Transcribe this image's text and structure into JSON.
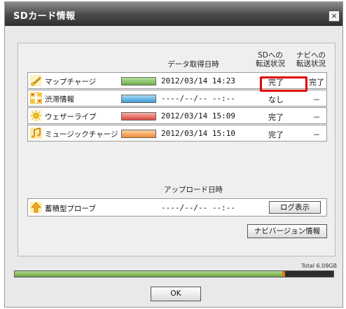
{
  "window": {
    "title": "SDカード情報",
    "close_label": "×"
  },
  "headers": {
    "date": "データ取得日時",
    "sd_line1": "SDへの",
    "sd_line2": "転送状況",
    "navi_line1": "ナビへの",
    "navi_line2": "転送状況"
  },
  "rows": [
    {
      "label": "マップチャージ",
      "date": "2012/03/14 14:23",
      "sd": "完了",
      "navi": "完了",
      "icon": "map-icon",
      "color": "#7fc163"
    },
    {
      "label": "渋滞情報",
      "date": "----/--/-- --:--",
      "sd": "なし",
      "navi": "－",
      "icon": "traffic-icon",
      "color": "#5fb6e8"
    },
    {
      "label": "ウェザーライブ",
      "date": "2012/03/14 15:09",
      "sd": "完了",
      "navi": "－",
      "icon": "weather-sun-icon",
      "color": "#e8706a"
    },
    {
      "label": "ミュージックチャージ",
      "date": "2012/03/14 15:10",
      "sd": "完了",
      "navi": "－",
      "icon": "music-note-icon",
      "color": "#f0a050"
    }
  ],
  "upload": {
    "header": "アップロード日時",
    "label": "蓄積型プローブ",
    "date": "----/--/-- --:--",
    "icon": "upload-arrow-icon",
    "log_button": "ログ表示"
  },
  "navi_version_button": "ナビバージョン情報",
  "storage": {
    "total_label": "Total 6.09GB",
    "used_fraction": 0.84
  },
  "ok_button": "OK"
}
